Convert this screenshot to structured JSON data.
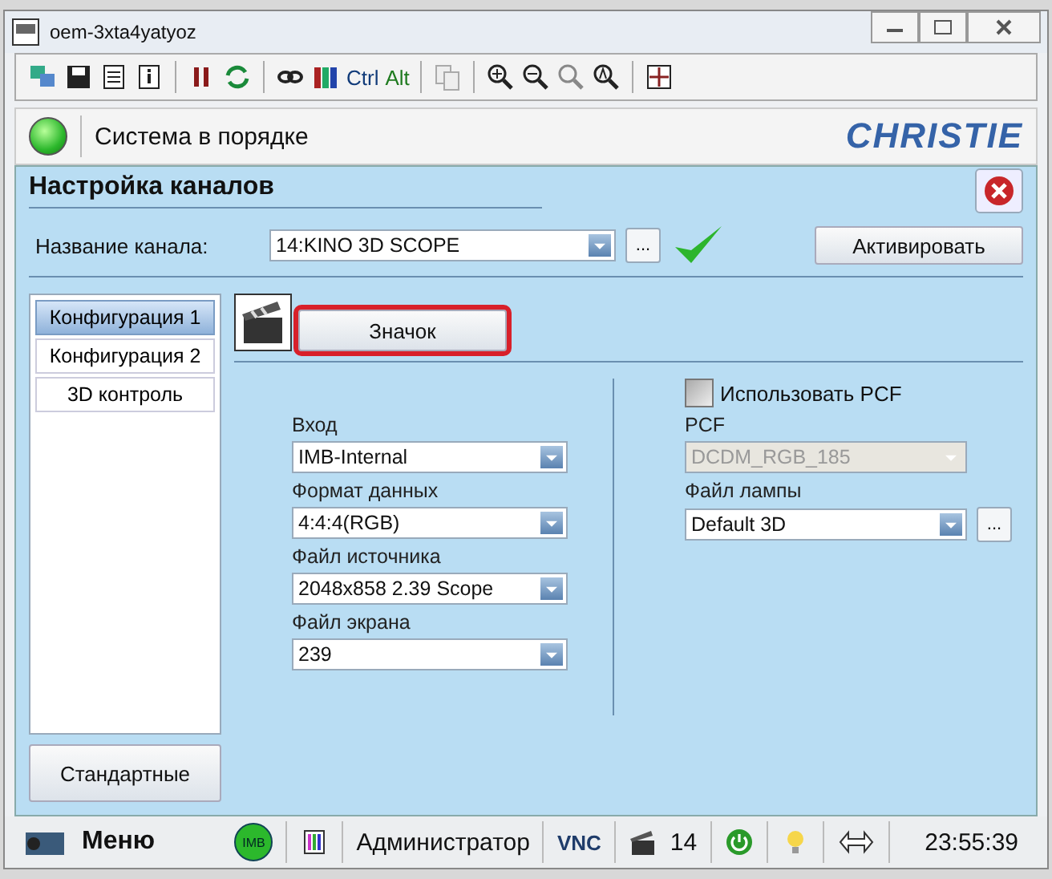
{
  "window": {
    "title": "oem-3xta4yatyoz"
  },
  "toolbar": {
    "ctrl_label": "Ctrl",
    "alt_label": "Alt"
  },
  "status_header": {
    "message": "Система в порядке",
    "logo": "CHRISTIE"
  },
  "panel": {
    "title": "Настройка каналов"
  },
  "channel": {
    "label": "Название канала:",
    "value": "14:KINO 3D SCOPE",
    "browse": "...",
    "activate_button": "Активировать"
  },
  "config_tabs": [
    {
      "label": "Конфигурация 1",
      "selected": true
    },
    {
      "label": "Конфигурация 2",
      "selected": false
    },
    {
      "label": "3D контроль",
      "selected": false
    }
  ],
  "default_button": "Стандартные",
  "icon_button": {
    "label": "Значок",
    "highlighted": true
  },
  "left_fields": [
    {
      "label": "Вход",
      "value": "IMB-Internal"
    },
    {
      "label": "Формат данных",
      "value": "4:4:4(RGB)"
    },
    {
      "label": "Файл источника",
      "value": "2048x858 2.39 Scope"
    },
    {
      "label": "Файл экрана",
      "value": "239"
    }
  ],
  "pcf_checkbox": {
    "label": "Использовать PCF",
    "checked": false
  },
  "pcf_field": {
    "label": "PCF",
    "value": "DCDM_RGB_185",
    "disabled": true
  },
  "lamp_field": {
    "label": "Файл лампы",
    "value": "Default 3D",
    "browse": "..."
  },
  "bottom_bar": {
    "menu": "Меню",
    "imb": "IMB",
    "user": "Администратор",
    "vnc": "VNC",
    "channel_count": "14",
    "time": "23:55:39"
  }
}
